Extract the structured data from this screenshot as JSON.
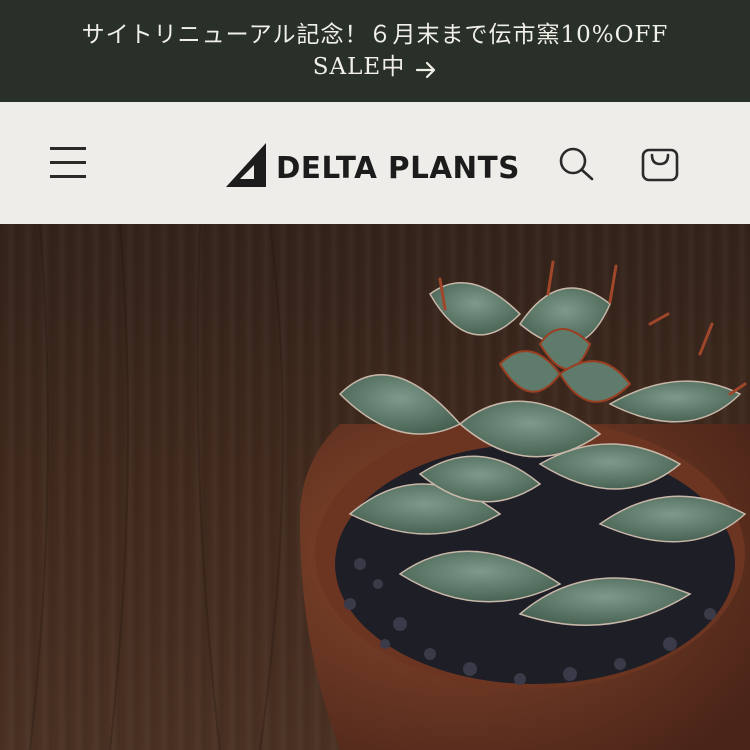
{
  "announcement": {
    "line1": "サイトリニューアル記念！６月末まで伝市窯10%OFF",
    "line2": "SALE中",
    "arrow_icon": "arrow-right-icon"
  },
  "header": {
    "brand": "DELTA PLANTS",
    "logo_icon": "delta-triangle-logo",
    "menu_icon": "hamburger-menu-icon",
    "search_icon": "search-icon",
    "cart_icon": "shopping-bag-icon"
  },
  "hero": {
    "image_subject": "agave plant in clay pot on dark wooden table"
  },
  "colors": {
    "announcement_bg": "#283029",
    "announcement_text": "#f0efe8",
    "header_bg": "#eeedea",
    "brand_text": "#1c1c1c"
  }
}
